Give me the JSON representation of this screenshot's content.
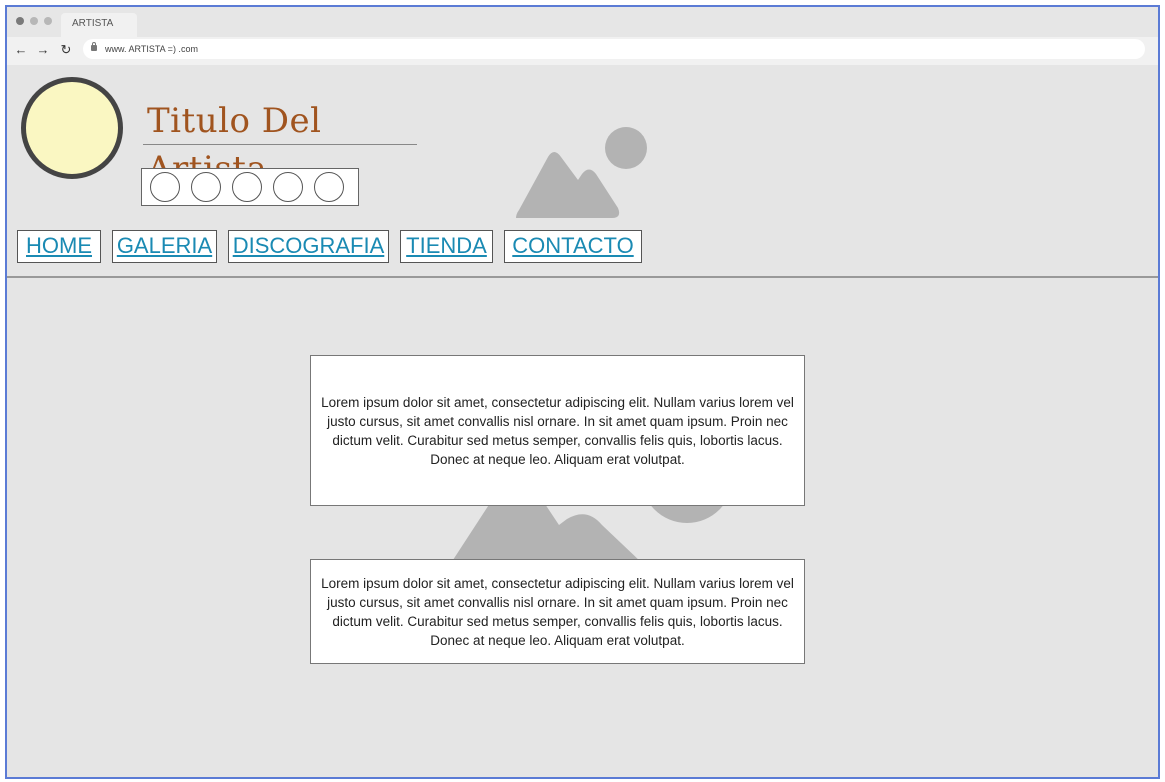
{
  "browser": {
    "tab_title": "ARTISTA",
    "url": "www. ARTISTA =) .com",
    "back_icon": "←",
    "forward_icon": "→",
    "reload_icon": "↻"
  },
  "header": {
    "artist_title": "Titulo Del Artista",
    "social_count": 5
  },
  "nav": {
    "items": [
      {
        "label": "HOME"
      },
      {
        "label": "GALERIA"
      },
      {
        "label": "DISCOGRAFIA"
      },
      {
        "label": "TIENDA"
      },
      {
        "label": "CONTACTO"
      }
    ]
  },
  "content": {
    "paragraph_1": "Lorem ipsum dolor sit amet, consectetur adipiscing elit. Nullam varius lorem vel justo cursus, sit amet convallis nisl ornare. In sit amet quam ipsum. Proin nec dictum velit. Curabitur sed metus semper, convallis felis quis, lobortis lacus. Donec at neque leo. Aliquam erat volutpat.",
    "paragraph_2": "Lorem ipsum dolor sit amet, consectetur adipiscing elit. Nullam varius lorem vel justo cursus, sit amet convallis nisl ornare. In sit amet quam ipsum. Proin nec dictum velit. Curabitur sed metus semper, convallis felis quis, lobortis lacus. Donec at neque leo. Aliquam erat volutpat."
  },
  "colors": {
    "frame_border": "#5b7bd5",
    "background": "#e5e5e5",
    "title": "#a0541f",
    "link": "#1a8ab3",
    "avatar_fill": "#faf7c2",
    "placeholder": "#b3b3b3"
  }
}
